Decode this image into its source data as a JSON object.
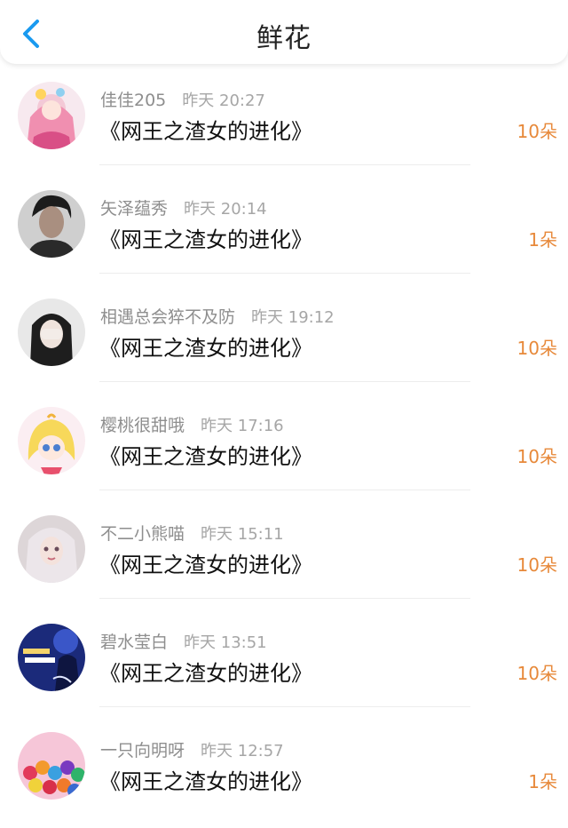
{
  "header": {
    "title": "鲜花",
    "back_icon": "chevron-left-icon",
    "accent": "#1a9af0"
  },
  "colors": {
    "amount": "#e7893a",
    "meta": "#8e8e8e"
  },
  "items": [
    {
      "user": "佳佳205",
      "time": "昨天 20:27",
      "book": "《网王之渣女的进化》",
      "amount": "10朵"
    },
    {
      "user": "矢泽蕴秀",
      "time": "昨天 20:14",
      "book": "《网王之渣女的进化》",
      "amount": "1朵"
    },
    {
      "user": "相遇总会猝不及防",
      "time": "昨天 19:12",
      "book": "《网王之渣女的进化》",
      "amount": "10朵"
    },
    {
      "user": "樱桃很甜哦",
      "time": "昨天 17:16",
      "book": "《网王之渣女的进化》",
      "amount": "10朵"
    },
    {
      "user": "不二小熊喵",
      "time": "昨天 15:11",
      "book": "《网王之渣女的进化》",
      "amount": "10朵"
    },
    {
      "user": "碧水莹白",
      "time": "昨天 13:51",
      "book": "《网王之渣女的进化》",
      "amount": "10朵"
    },
    {
      "user": "一只向明呀",
      "time": "昨天 12:57",
      "book": "《网王之渣女的进化》",
      "amount": "1朵"
    }
  ]
}
